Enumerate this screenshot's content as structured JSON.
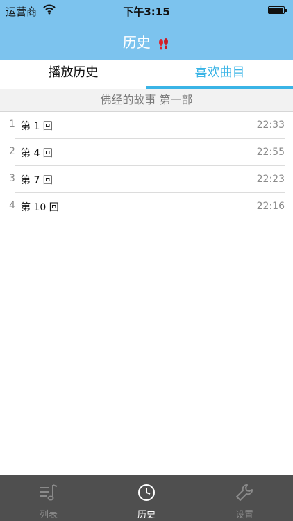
{
  "status_bar": {
    "carrier": "运营商",
    "time": "下午3:15"
  },
  "header": {
    "title": "历史",
    "title_icon": "footprints-icon"
  },
  "tabs": [
    {
      "label": "播放历史",
      "selected": false
    },
    {
      "label": "喜欢曲目",
      "selected": true
    }
  ],
  "section": {
    "title": "佛经的故事 第一部"
  },
  "list": [
    {
      "index": "1",
      "label": "第 1 回",
      "duration": "22:33"
    },
    {
      "index": "2",
      "label": "第 4 回",
      "duration": "22:55"
    },
    {
      "index": "3",
      "label": "第 7 回",
      "duration": "22:23"
    },
    {
      "index": "4",
      "label": "第 10 回",
      "duration": "22:16"
    }
  ],
  "tab_bar": [
    {
      "label": "列表",
      "icon": "music-list-icon",
      "active": false
    },
    {
      "label": "历史",
      "icon": "clock-icon",
      "active": true
    },
    {
      "label": "设置",
      "icon": "wrench-icon",
      "active": false
    }
  ],
  "colors": {
    "header_bg": "#7cc3ee",
    "accent": "#3ab4e6",
    "tabbar_bg": "#4f4f4f"
  }
}
